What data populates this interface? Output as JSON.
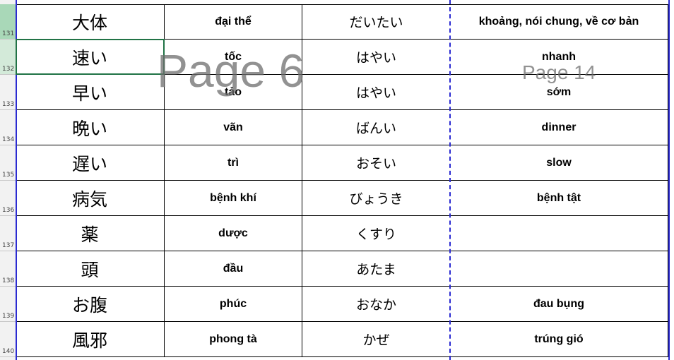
{
  "sheet": {
    "rows": [
      {
        "num": "131",
        "kanji": "大体",
        "hanviet": "đại thể",
        "kana": "だいたい",
        "meaning": "khoảng, nói chung, về cơ bản"
      },
      {
        "num": "132",
        "kanji": "速い",
        "hanviet": "tốc",
        "kana": "はやい",
        "meaning": "nhanh"
      },
      {
        "num": "133",
        "kanji": "早い",
        "hanviet": "tảo",
        "kana": "はやい",
        "meaning": "sớm"
      },
      {
        "num": "134",
        "kanji": "晩い",
        "hanviet": "vãn",
        "kana": "ばんい",
        "meaning": "dinner"
      },
      {
        "num": "135",
        "kanji": "遅い",
        "hanviet": "trì",
        "kana": "おそい",
        "meaning": "slow"
      },
      {
        "num": "136",
        "kanji": "病気",
        "hanviet": "bệnh khí",
        "kana": "びょうき",
        "meaning": "bệnh tật"
      },
      {
        "num": "137",
        "kanji": "薬",
        "hanviet": "dược",
        "kana": "くすり",
        "meaning": ""
      },
      {
        "num": "138",
        "kanji": "頭",
        "hanviet": "đầu",
        "kana": "あたま",
        "meaning": ""
      },
      {
        "num": "139",
        "kanji": "お腹",
        "hanviet": "phúc",
        "kana": "おなか",
        "meaning": "đau bụng"
      },
      {
        "num": "140",
        "kanji": "風邪",
        "hanviet": "phong tà",
        "kana": "かぜ",
        "meaning": "trúng gió"
      }
    ]
  },
  "watermarks": {
    "page_left": "Page 6",
    "page_right": "Page 14"
  },
  "colors": {
    "selection_border": "#217346",
    "page_break": "#2b2bd1",
    "row_header_selected": "#d3ead9"
  }
}
